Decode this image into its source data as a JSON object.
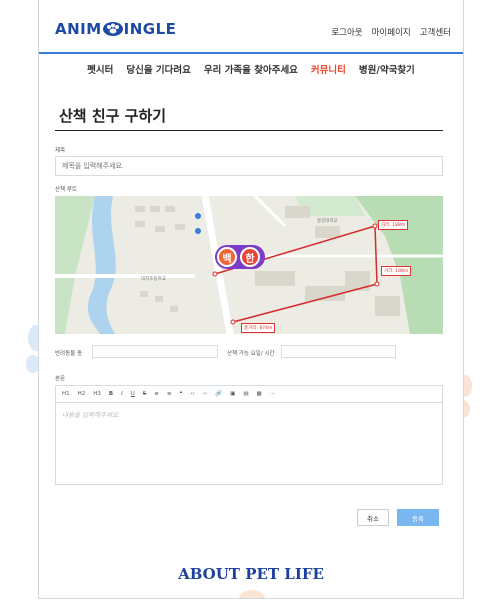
{
  "header": {
    "logo_left": "ANIM",
    "logo_right": "INGLE",
    "util_links": [
      "로그아웃",
      "마이페이지",
      "고객센터"
    ]
  },
  "nav": {
    "items": [
      "펫시터",
      "당신을 기다려요",
      "우리 가족을 찾아주세요",
      "커뮤니티",
      "병원/약국찾기"
    ],
    "active_index": 3
  },
  "page": {
    "title": "산책 친구 구하기"
  },
  "form": {
    "title_label": "제목",
    "title_placeholder": "제목을 입력해주세요.",
    "route_label": "산책 루트",
    "pet_type_label": "반려동물 종",
    "time_label": "산책 가능 요일/ 시간",
    "body_label": "본문",
    "body_placeholder": "내용을 입력해주세요."
  },
  "map": {
    "badges": [
      "백",
      "한"
    ],
    "distance_tags": [
      "거리: 188m",
      "거리: 188m",
      "총거리: 874m"
    ],
    "place_labels": [
      "용인대학교",
      "대지초등학교"
    ]
  },
  "editor": {
    "toolbar": [
      "H1",
      "H2",
      "H3",
      "B",
      "I",
      "U",
      "S",
      "≡",
      "≡",
      "❝",
      "‹›",
      "‹›",
      "🔗",
      "▣",
      "▤",
      "▦",
      "⋯"
    ]
  },
  "buttons": {
    "cancel": "취소",
    "submit": "등록"
  },
  "footer": {
    "title": "ABOUT PET LIFE"
  },
  "colors": {
    "accent_blue": "#3a7bd5",
    "nav_active": "#f0452b",
    "submit_bg": "#7ab6f0",
    "footer_text": "#1d3f9e",
    "route_line": "#d62b2b"
  }
}
